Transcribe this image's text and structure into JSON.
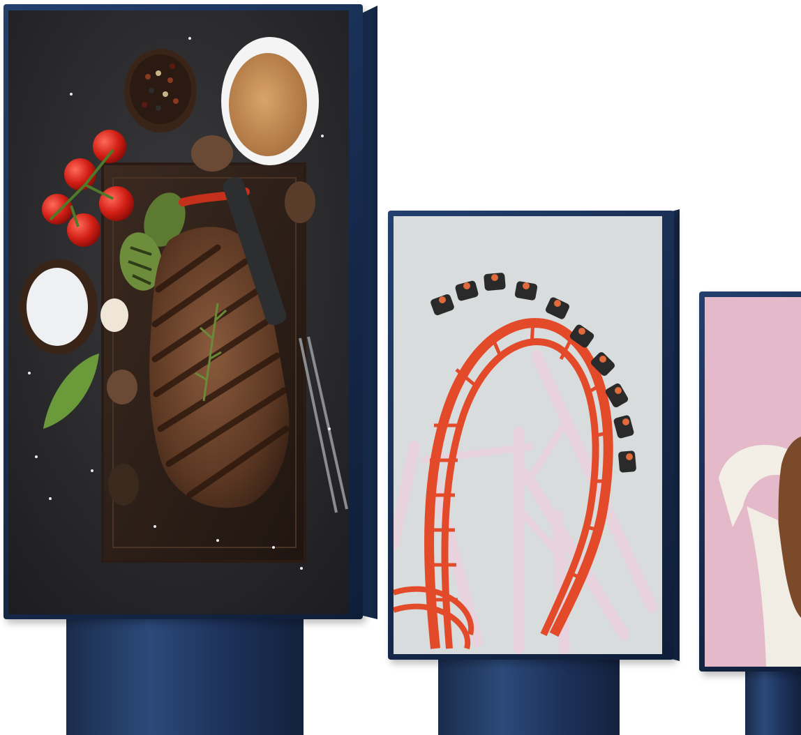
{
  "scene": {
    "description_free": true,
    "displays": [
      {
        "id": "display-food",
        "content": "steak-board-image"
      },
      {
        "id": "display-rollercoaster",
        "content": "rollercoaster-image"
      },
      {
        "id": "display-portrait",
        "content": "woman-portrait-image"
      }
    ],
    "colors": {
      "frame": "#1a3056",
      "food_background": "#2a2a2c",
      "sky": "#d7dbdc",
      "track": "#e34a2a",
      "support": "#e8d2de",
      "portrait_background": "#e4b9c9"
    }
  }
}
